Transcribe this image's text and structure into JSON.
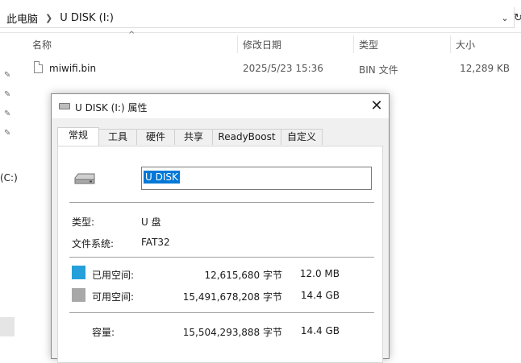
{
  "explorer": {
    "breadcrumb": [
      "此电脑",
      "U DISK (I:)"
    ],
    "columns": {
      "name": "名称",
      "date": "修改日期",
      "type": "类型",
      "size": "大小"
    },
    "files": [
      {
        "name": "miwifi.bin",
        "date": "2025/5/23 15:36",
        "type": "BIN 文件",
        "size": "12,289 KB",
        "icon": "file-icon"
      }
    ],
    "nav_pane": {
      "visible_label": "(C:)"
    }
  },
  "dialog": {
    "title": "U DISK (I:) 属性",
    "tabs": [
      "常规",
      "工具",
      "硬件",
      "共享",
      "ReadyBoost",
      "自定义"
    ],
    "active_tab": "常规",
    "volume_name": "U DISK",
    "type_label": "类型:",
    "type_value": "U 盘",
    "fs_label": "文件系统:",
    "fs_value": "FAT32",
    "used": {
      "label": "已用空间:",
      "bytes": "12,615,680 字节",
      "human": "12.0 MB",
      "color": "#26a0da"
    },
    "free": {
      "label": "可用空间:",
      "bytes": "15,491,678,208 字节",
      "human": "14.4 GB",
      "color": "#a8a8a8"
    },
    "capacity": {
      "label": "容量:",
      "bytes": "15,504,293,888 字节",
      "human": "14.4 GB"
    }
  },
  "icons": {
    "close": "close-icon",
    "drive": "usb-drive-icon",
    "pin": "pin-icon"
  }
}
